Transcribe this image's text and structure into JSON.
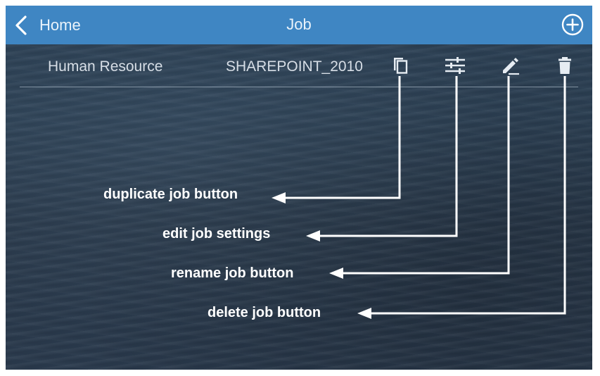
{
  "header": {
    "back_label": "Home",
    "title": "Job",
    "back_icon": "chevron-left-icon",
    "add_icon": "add-circle-icon"
  },
  "job": {
    "name": "Human Resource",
    "type": "SHAREPOINT_2010",
    "actions": [
      {
        "name": "duplicate-job",
        "icon": "copy-icon"
      },
      {
        "name": "edit-job-settings",
        "icon": "sliders-icon"
      },
      {
        "name": "rename-job",
        "icon": "pencil-icon"
      },
      {
        "name": "delete-job",
        "icon": "trash-icon"
      }
    ]
  },
  "callouts": {
    "duplicate": "duplicate job button",
    "edit_settings": "edit job settings",
    "rename": "rename job button",
    "delete": "delete job button"
  },
  "colors": {
    "header_bg": "#3f86c3",
    "background": "#2b3d50",
    "text_light": "#d7dee6",
    "callout": "#ffffff"
  }
}
